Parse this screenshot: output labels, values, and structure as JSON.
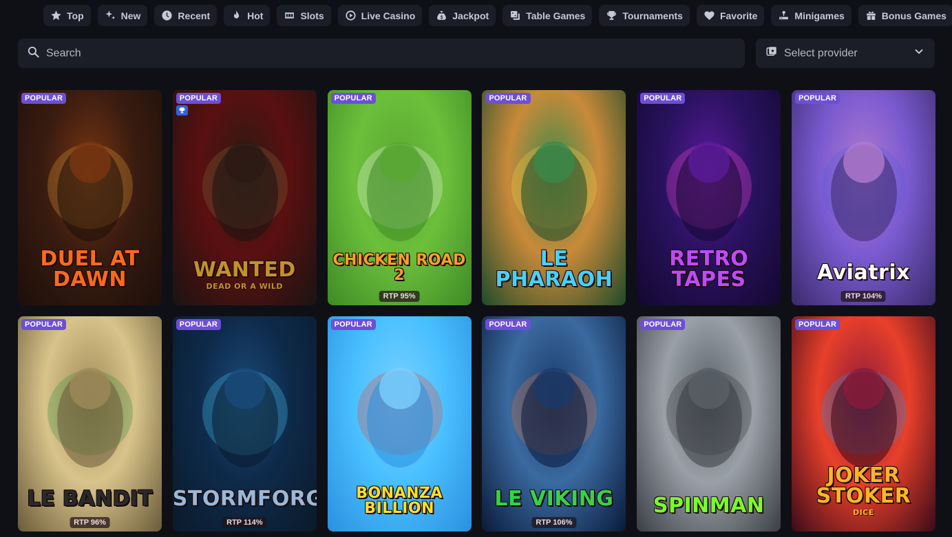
{
  "categories": [
    {
      "label": "Top",
      "icon": "star-icon"
    },
    {
      "label": "New",
      "icon": "sparkle-icon"
    },
    {
      "label": "Recent",
      "icon": "clock-icon"
    },
    {
      "label": "Hot",
      "icon": "flame-icon"
    },
    {
      "label": "Slots",
      "icon": "slot-machine-icon"
    },
    {
      "label": "Live Casino",
      "icon": "play-circle-icon"
    },
    {
      "label": "Jackpot",
      "icon": "money-bag-icon"
    },
    {
      "label": "Table Games",
      "icon": "dice-icon"
    },
    {
      "label": "Tournaments",
      "icon": "trophy-icon"
    },
    {
      "label": "Favorite",
      "icon": "heart-icon"
    },
    {
      "label": "Minigames",
      "icon": "joystick-icon"
    },
    {
      "label": "Bonus Games",
      "icon": "gift-icon"
    }
  ],
  "search": {
    "placeholder": "Search",
    "icon": "search-icon"
  },
  "provider": {
    "label": "Select provider",
    "icon": "provider-icon",
    "chevron": "chevron-down-icon"
  },
  "badge_label": "POPULAR",
  "games": [
    {
      "title": "DUEL AT DAWN",
      "badge": "POPULAR",
      "rtp": "",
      "bg": [
        "#3a1c10",
        "#7a3612",
        "#1c0f0a"
      ],
      "title_color": "#ff6a1f",
      "accent": "#e8a23a"
    },
    {
      "title": "WANTED",
      "subtitle": "DEAD OR A WILD",
      "badge": "POPULAR",
      "rtp": "",
      "trophy": true,
      "bg": [
        "#5a1010",
        "#2a1a14",
        "#1a1412"
      ],
      "title_color": "#c4902d",
      "accent": "#8a6a3a"
    },
    {
      "title": "CHICKEN ROAD 2",
      "badge": "POPULAR",
      "rtp": "RTP 95%",
      "bg": [
        "#6cbf3b",
        "#5aa832",
        "#3e8a26"
      ],
      "title_color": "#ff9f2a",
      "accent": "#ffffff"
    },
    {
      "title": "LE PHARAOH",
      "badge": "POPULAR",
      "rtp": "",
      "bg": [
        "#c98a3a",
        "#3a8a4a",
        "#1e4a2a"
      ],
      "title_color": "#4ad0ff",
      "accent": "#ffd34a"
    },
    {
      "title": "RETRO TAPES",
      "badge": "POPULAR",
      "rtp": "",
      "bg": [
        "#2a1260",
        "#5a1a9a",
        "#120830"
      ],
      "title_color": "#c04aff",
      "accent": "#ff4ad8"
    },
    {
      "title": "Aviatrix",
      "badge": "POPULAR",
      "rtp": "RTP 104%",
      "bg": [
        "#7a5ad0",
        "#b07ad0",
        "#3a2a6a"
      ],
      "title_color": "#ffffff",
      "accent": "#5a5ae0"
    },
    {
      "title": "LE BANDIT",
      "badge": "POPULAR",
      "rtp": "RTP 96%",
      "bg": [
        "#d8c48a",
        "#a08a5a",
        "#6a5a3a"
      ],
      "title_color": "#2a2a2a",
      "accent": "#2a8a3a"
    },
    {
      "title": "STORMFORGED",
      "badge": "POPULAR",
      "rtp": "RTP 114%",
      "bg": [
        "#0e2a4a",
        "#1a4a7a",
        "#0a1a2a"
      ],
      "title_color": "#9ab8d8",
      "accent": "#4ad0ff"
    },
    {
      "title": "BONANZA BILLION",
      "badge": "POPULAR",
      "rtp": "",
      "bg": [
        "#4ac0ff",
        "#7ad0ff",
        "#2a90e0"
      ],
      "title_color": "#ffe02a",
      "accent": "#e8402a"
    },
    {
      "title": "LE VIKING",
      "badge": "POPULAR",
      "rtp": "RTP 106%",
      "bg": [
        "#3a6aa0",
        "#1a3a6a",
        "#0a1a3a"
      ],
      "title_color": "#3ad04a",
      "accent": "#e8743a"
    },
    {
      "title": "SPINMAN",
      "badge": "POPULAR",
      "rtp": "",
      "bg": [
        "#9aa0a8",
        "#5a6068",
        "#3a3e44"
      ],
      "title_color": "#7aff2a",
      "accent": "#2a2a2a"
    },
    {
      "title": "JOKER STOKER",
      "subtitle": "DICE",
      "badge": "POPULAR",
      "rtp": "",
      "bg": [
        "#e8402a",
        "#8a1a3a",
        "#3a0a1a"
      ],
      "title_color": "#ffb42a",
      "accent": "#2a90e0"
    }
  ]
}
